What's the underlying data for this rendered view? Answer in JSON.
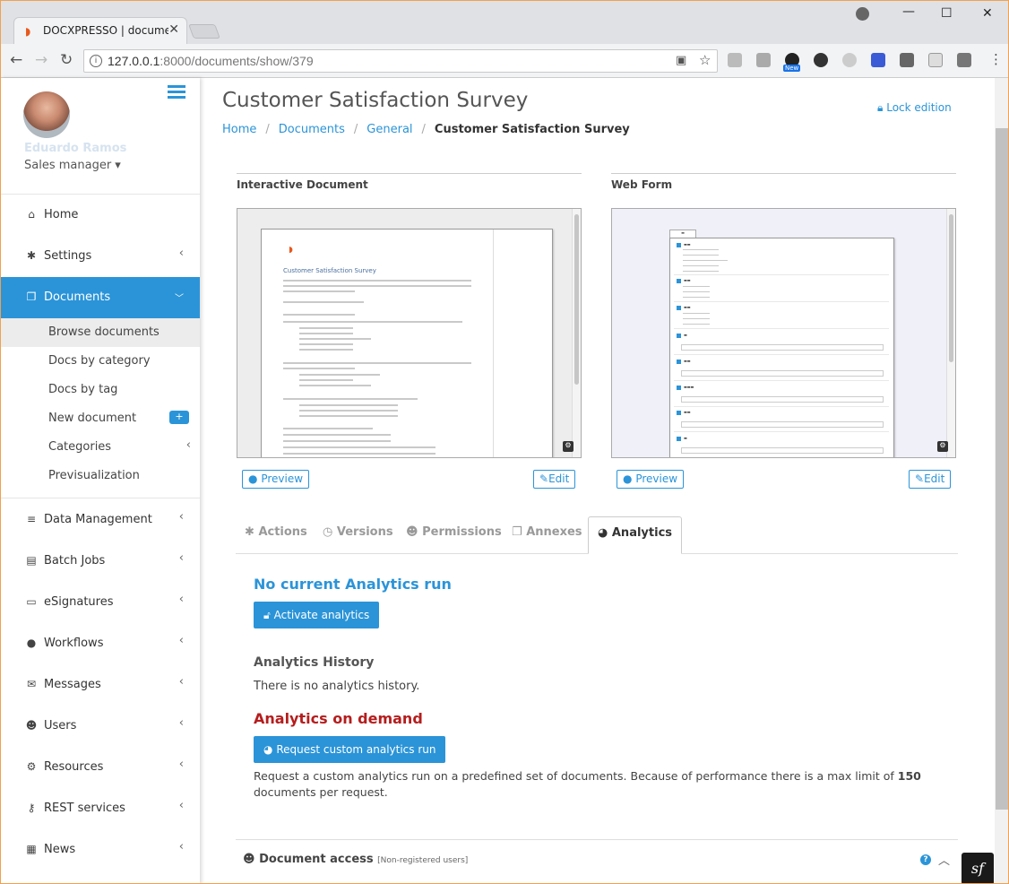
{
  "browser": {
    "tab_title": "DOCXPRESSO | documen",
    "url_host": "127.0.0.1",
    "url_path": ":8000/documents/show/379",
    "new_badge": "New"
  },
  "user": {
    "name": "Eduardo Ramos",
    "role": "Sales manager ▾"
  },
  "sidebar": {
    "items": [
      {
        "label": "Home",
        "icon": "home-icon"
      },
      {
        "label": "Settings",
        "icon": "gear-icon"
      },
      {
        "label": "Documents",
        "icon": "copy-icon"
      },
      {
        "label": "Data Management",
        "icon": "database-icon"
      },
      {
        "label": "Batch Jobs",
        "icon": "book-icon"
      },
      {
        "label": "eSignatures",
        "icon": "id-card-icon"
      },
      {
        "label": "Workflows",
        "icon": "globe-icon"
      },
      {
        "label": "Messages",
        "icon": "envelope-icon"
      },
      {
        "label": "Users",
        "icon": "users-icon"
      },
      {
        "label": "Resources",
        "icon": "cogs-icon"
      },
      {
        "label": "REST services",
        "icon": "key-icon"
      },
      {
        "label": "News",
        "icon": "newspaper-icon"
      }
    ],
    "sub": [
      "Browse documents",
      "Docs by category",
      "Docs by tag",
      "New document",
      "Categories",
      "Previsualization"
    ],
    "plus": "+"
  },
  "page": {
    "title": "Customer Satisfaction Survey",
    "lock": "Lock edition",
    "breadcrumb": [
      "Home",
      "Documents",
      "General",
      "Customer Satisfaction Survey"
    ]
  },
  "panes": {
    "left_title": "Interactive Document",
    "right_title": "Web Form",
    "preview": "Preview",
    "edit": "Edit"
  },
  "doc_preview": {
    "heading": "Customer Satisfaction Survey"
  },
  "tabs": [
    "Actions",
    "Versions",
    "Permissions",
    "Annexes",
    "Analytics"
  ],
  "analytics": {
    "no_current": "No current Analytics run",
    "activate": "Activate analytics",
    "history_title": "Analytics History",
    "no_history": "There is no analytics history.",
    "on_demand": "Analytics on demand",
    "request_btn": "Request custom analytics run",
    "request_text_a": "Request a custom analytics run on a predefined set of documents. Because of performance there is a max limit of ",
    "request_limit": "150",
    "request_text_b": " documents per request."
  },
  "doc_access": {
    "title": "Document access",
    "note": "[Non-registered users]"
  }
}
